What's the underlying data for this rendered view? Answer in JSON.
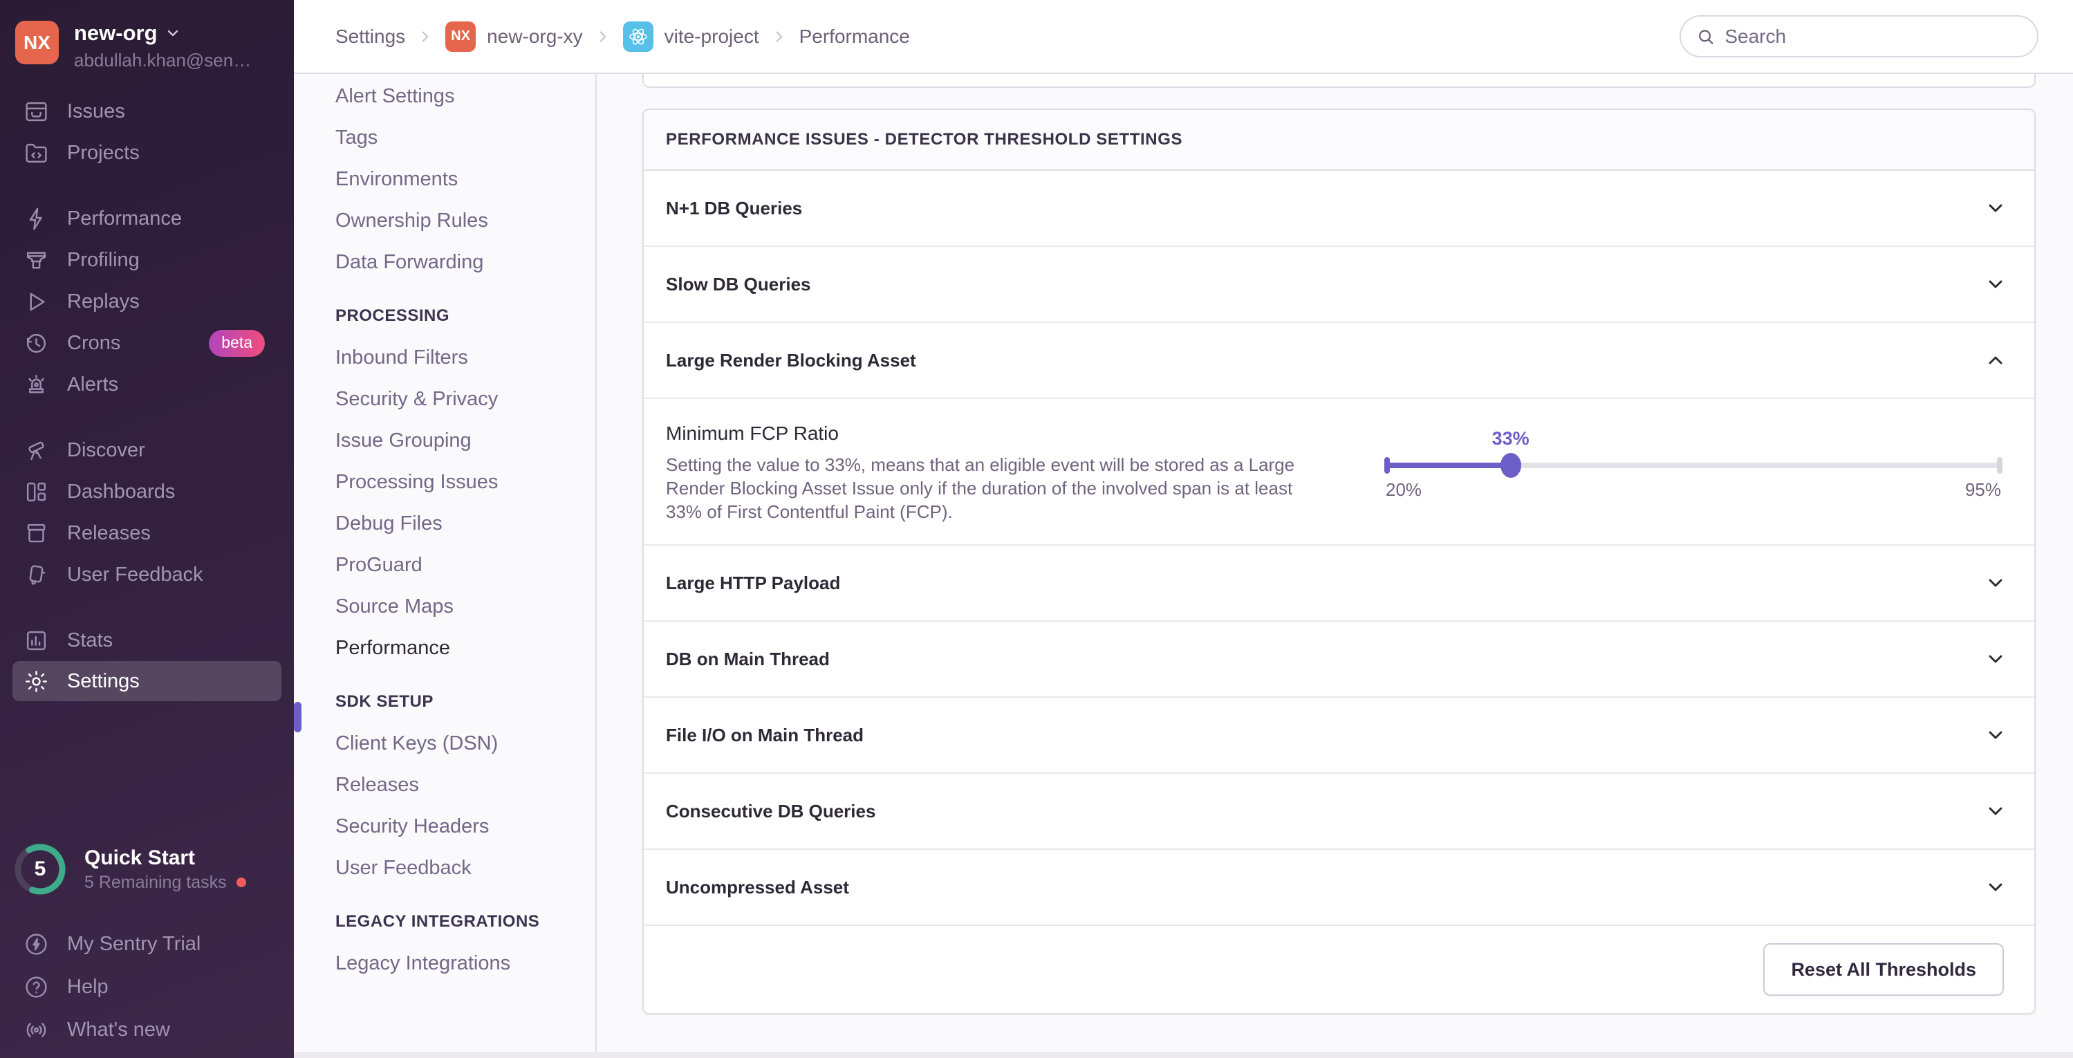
{
  "org": {
    "initials": "NX",
    "name": "new-org",
    "email": "abdullah.khan@sen…"
  },
  "sidebar": {
    "items": [
      "Issues",
      "Projects",
      "Performance",
      "Profiling",
      "Replays",
      "Crons",
      "Alerts",
      "Discover",
      "Dashboards",
      "Releases",
      "User Feedback",
      "Stats",
      "Settings"
    ],
    "crons_badge": "beta"
  },
  "quick_start": {
    "count": "5",
    "title": "Quick Start",
    "subtitle": "5 Remaining tasks"
  },
  "sidebar_footer": {
    "trial": "My Sentry Trial",
    "help": "Help",
    "whats_new": "What's new"
  },
  "breadcrumb": {
    "settings": "Settings",
    "org_badge": "NX",
    "org": "new-org-xy",
    "project": "vite-project",
    "page": "Performance"
  },
  "search": {
    "placeholder": "Search"
  },
  "settings_nav": {
    "top": [
      "Alert Settings",
      "Tags",
      "Environments",
      "Ownership Rules",
      "Data Forwarding"
    ],
    "processing_heading": "PROCESSING",
    "processing": [
      "Inbound Filters",
      "Security & Privacy",
      "Issue Grouping",
      "Processing Issues",
      "Debug Files",
      "ProGuard",
      "Source Maps",
      "Performance"
    ],
    "sdk_heading": "SDK SETUP",
    "sdk": [
      "Client Keys (DSN)",
      "Releases",
      "Security Headers",
      "User Feedback"
    ],
    "legacy_heading": "LEGACY INTEGRATIONS",
    "legacy": [
      "Legacy Integrations"
    ]
  },
  "panel": {
    "header": "PERFORMANCE ISSUES - DETECTOR THRESHOLD SETTINGS",
    "rows": [
      "N+1 DB Queries",
      "Slow DB Queries",
      "Large Render Blocking Asset",
      "Large HTTP Payload",
      "DB on Main Thread",
      "File I/O on Main Thread",
      "Consecutive DB Queries",
      "Uncompressed Asset"
    ],
    "expanded": {
      "title": "Minimum FCP Ratio",
      "description": "Setting the value to 33%, means that an eligible event will be stored as a Large Render Blocking Asset Issue only if the duration of the involved span is at least 33% of First Contentful Paint (FCP).",
      "value_label": "33%",
      "min_label": "20%",
      "max_label": "95%",
      "percent": 20.3
    },
    "reset_button": "Reset All Thresholds"
  },
  "colors": {
    "accent": "#6d5fc8",
    "org_badge": "#e5664d",
    "project_badge": "#56c0e8",
    "danger_dot": "#ee5e5e",
    "progress_green": "#3eac8a"
  }
}
